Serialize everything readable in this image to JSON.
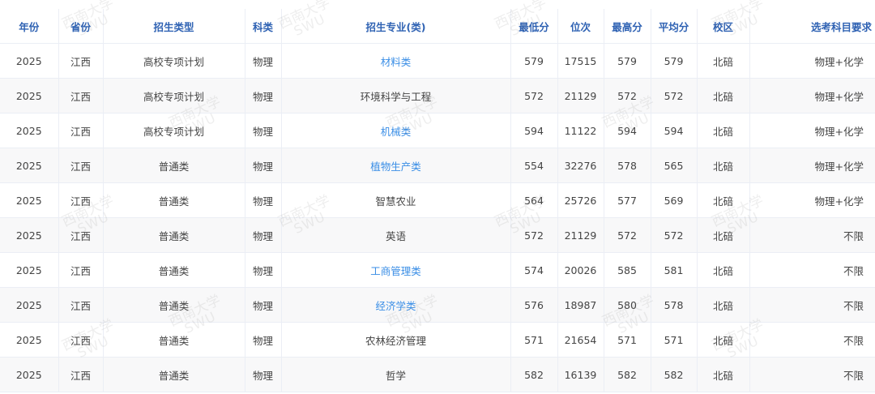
{
  "table": {
    "headers": {
      "year": "年份",
      "province": "省份",
      "enroll_type": "招生类型",
      "subject": "科类",
      "major": "招生专业(类)",
      "min_score": "最低分",
      "rank": "位次",
      "max_score": "最高分",
      "avg_score": "平均分",
      "campus": "校区",
      "requirement": "选考科目要求"
    },
    "rows": [
      {
        "year": "2025",
        "province": "江西",
        "enroll_type": "高校专项计划",
        "subject": "物理",
        "major": "材料类",
        "major_link": true,
        "min_score": "579",
        "rank": "17515",
        "max_score": "579",
        "avg_score": "579",
        "campus": "北碚",
        "requirement": "物理+化学"
      },
      {
        "year": "2025",
        "province": "江西",
        "enroll_type": "高校专项计划",
        "subject": "物理",
        "major": "环境科学与工程",
        "major_link": false,
        "min_score": "572",
        "rank": "21129",
        "max_score": "572",
        "avg_score": "572",
        "campus": "北碚",
        "requirement": "物理+化学"
      },
      {
        "year": "2025",
        "province": "江西",
        "enroll_type": "高校专项计划",
        "subject": "物理",
        "major": "机械类",
        "major_link": true,
        "min_score": "594",
        "rank": "11122",
        "max_score": "594",
        "avg_score": "594",
        "campus": "北碚",
        "requirement": "物理+化学"
      },
      {
        "year": "2025",
        "province": "江西",
        "enroll_type": "普通类",
        "subject": "物理",
        "major": "植物生产类",
        "major_link": true,
        "min_score": "554",
        "rank": "32276",
        "max_score": "578",
        "avg_score": "565",
        "campus": "北碚",
        "requirement": "物理+化学"
      },
      {
        "year": "2025",
        "province": "江西",
        "enroll_type": "普通类",
        "subject": "物理",
        "major": "智慧农业",
        "major_link": false,
        "min_score": "564",
        "rank": "25726",
        "max_score": "577",
        "avg_score": "569",
        "campus": "北碚",
        "requirement": "物理+化学"
      },
      {
        "year": "2025",
        "province": "江西",
        "enroll_type": "普通类",
        "subject": "物理",
        "major": "英语",
        "major_link": false,
        "min_score": "572",
        "rank": "21129",
        "max_score": "572",
        "avg_score": "572",
        "campus": "北碚",
        "requirement": "不限"
      },
      {
        "year": "2025",
        "province": "江西",
        "enroll_type": "普通类",
        "subject": "物理",
        "major": "工商管理类",
        "major_link": true,
        "min_score": "574",
        "rank": "20026",
        "max_score": "585",
        "avg_score": "581",
        "campus": "北碚",
        "requirement": "不限"
      },
      {
        "year": "2025",
        "province": "江西",
        "enroll_type": "普通类",
        "subject": "物理",
        "major": "经济学类",
        "major_link": true,
        "min_score": "576",
        "rank": "18987",
        "max_score": "580",
        "avg_score": "578",
        "campus": "北碚",
        "requirement": "不限"
      },
      {
        "year": "2025",
        "province": "江西",
        "enroll_type": "普通类",
        "subject": "物理",
        "major": "农林经济管理",
        "major_link": false,
        "min_score": "571",
        "rank": "21654",
        "max_score": "571",
        "avg_score": "571",
        "campus": "北碚",
        "requirement": "不限"
      },
      {
        "year": "2025",
        "province": "江西",
        "enroll_type": "普通类",
        "subject": "物理",
        "major": "哲学",
        "major_link": false,
        "min_score": "582",
        "rank": "16139",
        "max_score": "582",
        "avg_score": "582",
        "campus": "北碚",
        "requirement": "不限"
      }
    ]
  },
  "watermark": {
    "cn": "西南大学",
    "en": "SWU"
  },
  "colors": {
    "header_text": "#2f62b3",
    "link": "#3a8ee6",
    "row_alt": "#f8f8f9",
    "border": "#ebeef5"
  }
}
